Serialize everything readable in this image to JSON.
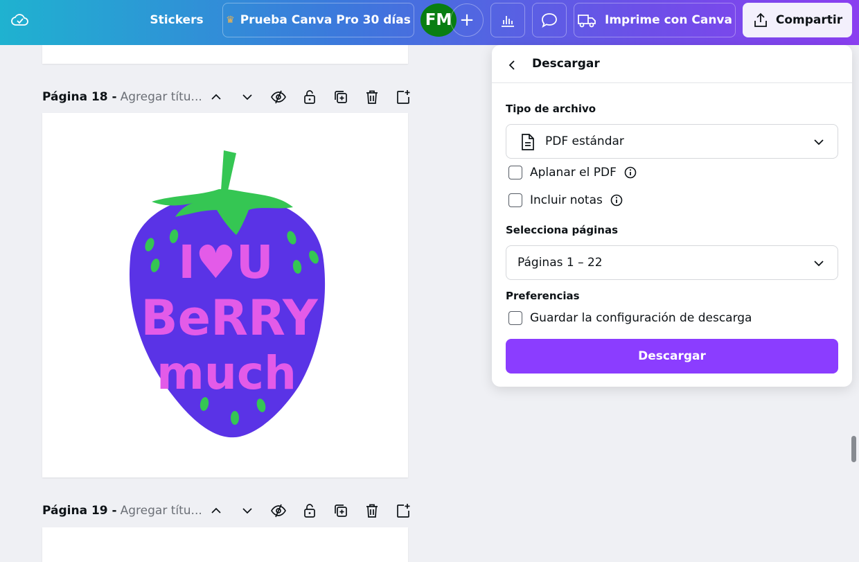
{
  "topbar": {
    "stickers_label": "Stickers",
    "pro_label": "Prueba Canva Pro 30 días",
    "avatar_initials": "FM",
    "print_label": "Imprime con Canva",
    "share_label": "Compartir"
  },
  "pages": [
    {
      "number_label": "Página 18 -",
      "title_placeholder": "Agregar títu..."
    },
    {
      "number_label": "Página 19 -",
      "title_placeholder": "Agregar títu..."
    }
  ],
  "artwork": {
    "line1": "I♥U",
    "line2": "BeRRY",
    "line3": "much",
    "colors": {
      "body": "#5a33e6",
      "leaves": "#35c653",
      "text": "#e35be8",
      "seeds": "#35c653"
    }
  },
  "download_panel": {
    "title": "Descargar",
    "file_type_label": "Tipo de archivo",
    "file_type_value": "PDF estándar",
    "flatten_label": "Aplanar el PDF",
    "notes_label": "Incluir notas",
    "pages_label": "Selecciona páginas",
    "pages_value": "Páginas 1 – 22",
    "prefs_label": "Preferencias",
    "save_settings_label": "Guardar la configuración de descarga",
    "download_button": "Descargar",
    "accent_color": "#8b3dff"
  }
}
